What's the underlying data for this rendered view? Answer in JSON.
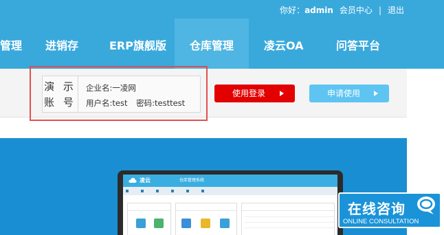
{
  "topbar": {
    "greeting": "你好：",
    "username": "admin",
    "member_center": "会员中心",
    "divider": "|",
    "logout": "退出"
  },
  "nav": {
    "items": [
      {
        "label": "管理"
      },
      {
        "label": "进销存"
      },
      {
        "label": "ERP旗舰版"
      },
      {
        "label": "仓库管理",
        "active": true
      },
      {
        "label": "凌云OA"
      },
      {
        "label": "问答平台"
      }
    ]
  },
  "demo": {
    "label_line1": "演 示",
    "label_line2": "账 号",
    "company": "企业名:一凌网",
    "username": "用户名:test",
    "password": "密码:testtest",
    "login_button": "使用登录",
    "apply_button": "申请使用"
  },
  "colors": {
    "nav_bg": "#39a9dc",
    "nav_active": "#4fb5e3",
    "login_btn": "#e20000",
    "apply_btn": "#5ec4f2",
    "highlight_box": "#e0504f",
    "banner": "#1a8ed2"
  },
  "banner_app": {
    "title": "仓库管理系统"
  },
  "consult": {
    "title": "在线咨询",
    "subtitle": "ONLINE CONSULTATION",
    "icon": "chat-bubble-icon"
  }
}
